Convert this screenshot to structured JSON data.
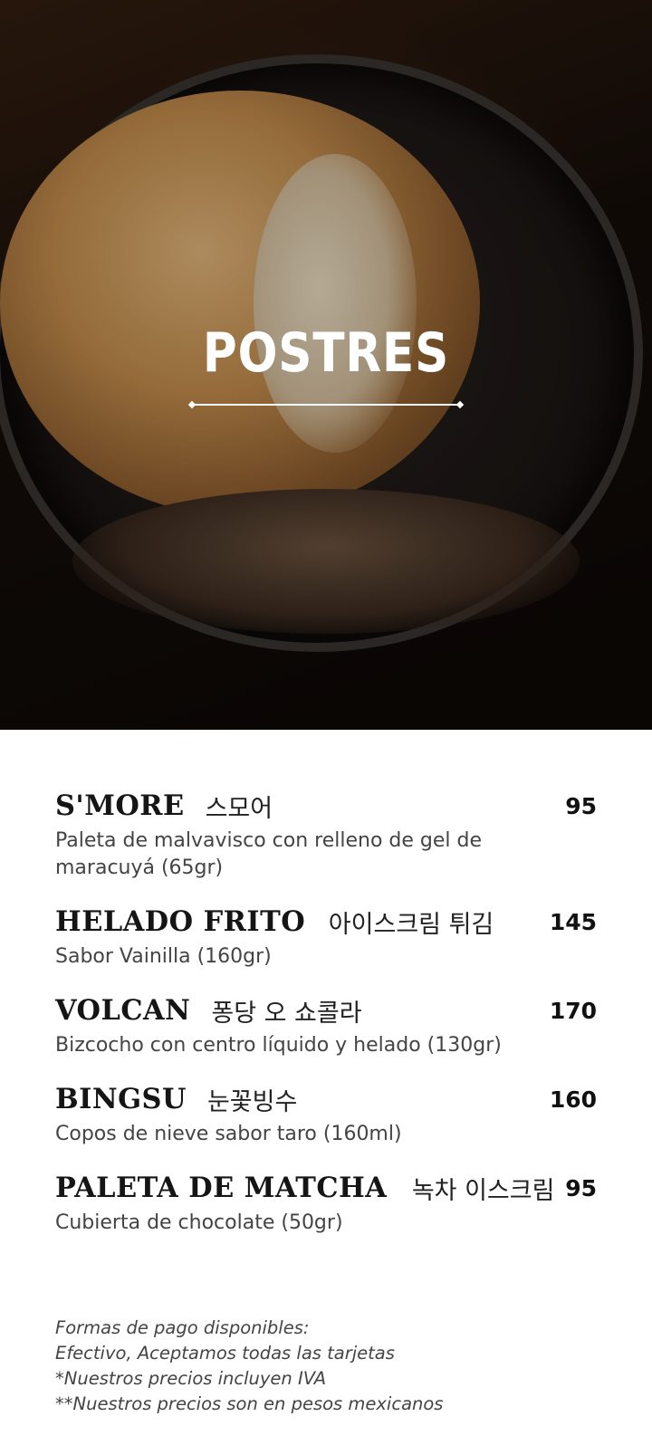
{
  "hero": {
    "title": "POSTRES"
  },
  "items": [
    {
      "name": "S'MORE",
      "korean": "스모어",
      "price": "95",
      "desc": "Paleta de malvavisco con relleno de gel de maracuyá (65gr)"
    },
    {
      "name": "HELADO FRITO",
      "korean": "아이스크림 튀김",
      "price": "145",
      "desc": "Sabor Vainilla (160gr)"
    },
    {
      "name": "VOLCAN",
      "korean": "퐁당 오 쇼콜라",
      "price": "170",
      "desc": "Bizcocho con centro líquido y helado (130gr)"
    },
    {
      "name": "BINGSU",
      "korean": "눈꽃빙수",
      "price": "160",
      "desc": "Copos de nieve sabor taro (160ml)"
    },
    {
      "name": "PALETA DE MATCHA",
      "korean": "녹차 이스크림",
      "price": "95",
      "desc": "Cubierta de chocolate (50gr)"
    }
  ],
  "footer": {
    "line1": "Formas de pago disponibles:",
    "line2": "Efectivo, Aceptamos todas las tarjetas",
    "line3": "*Nuestros precios incluyen IVA",
    "line4": "**Nuestros precios son en pesos mexicanos"
  }
}
